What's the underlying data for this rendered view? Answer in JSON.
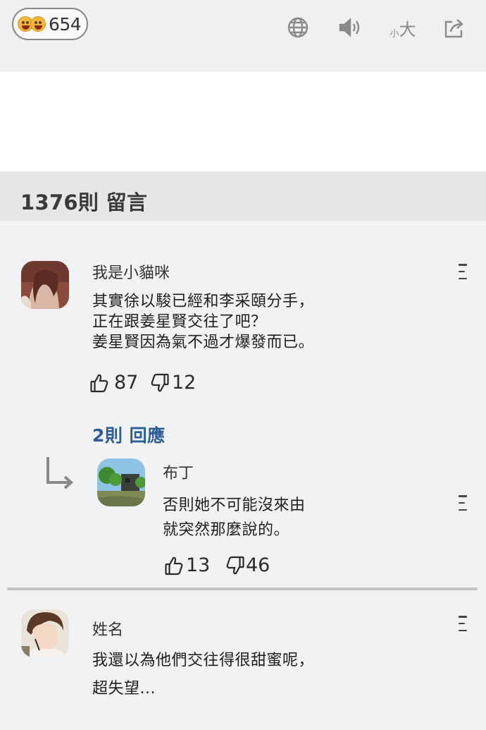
{
  "toolbar": {
    "reaction_count": "654",
    "icons": [
      "happy-emoji",
      "laughing-emoji",
      "globe-icon",
      "speaker-icon",
      "font-size-icon",
      "share-icon"
    ],
    "font_small": "小",
    "font_big": "大"
  },
  "comments": {
    "title": "1376則 留言",
    "items": [
      {
        "username": "我是小貓咪",
        "lines": [
          "其實徐以駿已經和李采頤分手，",
          "正在跟姜星賢交往了吧？",
          "姜星賢因為氣不過才爆發而已。"
        ],
        "likes": "87",
        "dislikes": "12",
        "replies_label": "2則 回應",
        "replies": [
          {
            "username": "布丁",
            "lines": [
              "否則她不可能沒來由",
              "就突然那麼說的。"
            ],
            "likes": "13",
            "dislikes": "46"
          }
        ]
      },
      {
        "username": "姓名",
        "lines": [
          "我還以為他們交往得很甜蜜呢，",
          "超失望..."
        ]
      }
    ]
  },
  "colors": {
    "toolbar_bg": "#eef0f1",
    "page_bg": "#f1f2f3",
    "header_bg": "#e6e7e9",
    "link": "#2b5d9b"
  }
}
